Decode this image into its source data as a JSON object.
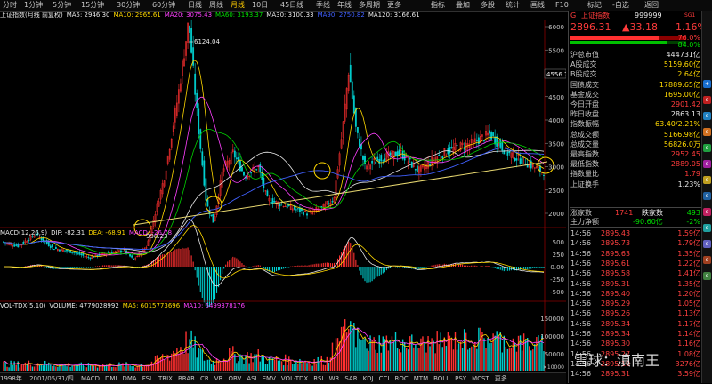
{
  "toolbar": {
    "periods": [
      "分时",
      "1分钟",
      "5分钟",
      "15分钟",
      "30分钟",
      "60分钟",
      "日线",
      "周线",
      "月线",
      "10日",
      "45日线",
      "季线",
      "年线",
      "多周期",
      "更多"
    ],
    "active_period": "月线",
    "right_buttons": [
      "指标",
      "叠加",
      "多股",
      "统计",
      "画线",
      "F10",
      "标记",
      "-自选",
      "返回"
    ]
  },
  "ma_legend": [
    {
      "text": "上证指数(月线 前复权)",
      "color": "#e8e8e8"
    },
    {
      "text": "MA5: 2946.30",
      "color": "#e8e8e8"
    },
    {
      "text": "MA10: 2965.61",
      "color": "#ffd800"
    },
    {
      "text": "MA20: 3075.43",
      "color": "#ff40ff"
    },
    {
      "text": "MA60: 3193.37",
      "color": "#00e000"
    },
    {
      "text": "MA30: 3100.33",
      "color": "#e8e8e8"
    },
    {
      "text": "MA90: 2750.82",
      "color": "#4060ff"
    },
    {
      "text": "MA120: 3166.61",
      "color": "#e8e8e8"
    }
  ],
  "price_axis": [
    "6000",
    "5500",
    "5000",
    "4500",
    "4000",
    "3500",
    "3000",
    "2500",
    "2000"
  ],
  "price_annotations": {
    "high": "6124.04",
    "low": "998.23",
    "right_mark": "4556.7"
  },
  "macd": {
    "legend": [
      {
        "text": "MACD(12,26,9)",
        "color": "#e8e8e8"
      },
      {
        "text": "DIF: -82.31",
        "color": "#e8e8e8"
      },
      {
        "text": "DEA: -68.91",
        "color": "#ffd800"
      },
      {
        "text": "MACD: -26.78",
        "color": "#ff40ff"
      }
    ],
    "axis": [
      "500",
      "250",
      "0.00",
      "-250",
      "-500"
    ]
  },
  "vol": {
    "legend": [
      {
        "text": "VOL-TDX(5,10)",
        "color": "#e8e8e8"
      },
      {
        "text": "VOLUME: 4779028992",
        "color": "#e8e8e8"
      },
      {
        "text": "MA5: 6015773696",
        "color": "#ffd800"
      },
      {
        "text": "MA10: 6499378176",
        "color": "#ff40ff"
      }
    ],
    "axis": [
      "150000",
      "100000",
      "50000"
    ],
    "axis_unit": "×10000"
  },
  "bottom_bar": {
    "start_year": "1998年",
    "date_label": "2001/05/31/四",
    "indicators": [
      "MACD",
      "DMI",
      "DMA",
      "FSL",
      "TRIX",
      "BRAR",
      "CR",
      "VR",
      "OBV",
      "ASI",
      "EMV",
      "VOL-TDX",
      "RSI",
      "WR",
      "SAR",
      "KDJ",
      "CCI",
      "ROC",
      "MTM",
      "BOLL",
      "PSY",
      "MCST",
      "更多"
    ]
  },
  "quote": {
    "index_name": "上证指数",
    "code": "999999",
    "flag": "SG1",
    "price": "2896.31",
    "change": "▲33.18",
    "pct": "1.16%",
    "buy_pct": "76.0%",
    "sell_pct": "84.0%"
  },
  "stats": [
    {
      "k": "沪总市值",
      "v": "444731亿",
      "c": "white"
    },
    {
      "k": "A股成交",
      "v": "5159.60亿",
      "c": "yellow"
    },
    {
      "k": "B股成交",
      "v": "2.64亿",
      "c": "yellow"
    },
    {
      "k": "国债成交",
      "v": "17889.65亿",
      "c": "yellow"
    },
    {
      "k": "基金成交",
      "v": "1695.00亿",
      "c": "yellow"
    },
    {
      "k": "今日开盘",
      "v": "2901.42",
      "c": "red"
    },
    {
      "k": "昨日收盘",
      "v": "2863.13",
      "c": "white"
    },
    {
      "k": "指数振幅",
      "v": "63.40/2.21%",
      "c": "yellow"
    },
    {
      "k": "总成交额",
      "v": "5166.98亿",
      "c": "yellow"
    },
    {
      "k": "总成交量",
      "v": "56826.0万",
      "c": "yellow"
    },
    {
      "k": "最高指数",
      "v": "2952.45",
      "c": "red"
    },
    {
      "k": "最低指数",
      "v": "2889.05",
      "c": "red"
    },
    {
      "k": "指数量比",
      "v": "1.79",
      "c": "red"
    },
    {
      "k": "上证换手",
      "v": "1.23%",
      "c": "white"
    }
  ],
  "breadth": {
    "up_label": "涨家数",
    "up": "1741",
    "down_label": "跌家数",
    "down": "493"
  },
  "netflow": {
    "label": "主力净额",
    "value": "-90.60亿",
    "pct": "-2%"
  },
  "ticks": [
    {
      "t": "14:56",
      "p": "2895.43",
      "q": "1.59亿"
    },
    {
      "t": "14:56",
      "p": "2895.73",
      "q": "1.79亿"
    },
    {
      "t": "14:56",
      "p": "2895.63",
      "q": "1.35亿"
    },
    {
      "t": "14:56",
      "p": "2895.61",
      "q": "1.22亿"
    },
    {
      "t": "14:56",
      "p": "2895.58",
      "q": "1.41亿"
    },
    {
      "t": "14:56",
      "p": "2895.31",
      "q": "1.35亿"
    },
    {
      "t": "14:56",
      "p": "2895.40",
      "q": "1.20亿"
    },
    {
      "t": "14:56",
      "p": "2895.29",
      "q": "1.05亿"
    },
    {
      "t": "14:56",
      "p": "2895.26",
      "q": "1.13亿"
    },
    {
      "t": "14:56",
      "p": "2895.34",
      "q": "1.17亿"
    },
    {
      "t": "14:56",
      "p": "2895.34",
      "q": "1.14亿"
    },
    {
      "t": "14:56",
      "p": "2895.30",
      "q": "1.16亿"
    },
    {
      "t": "14:56",
      "p": "2895.27",
      "q": "1.08亿"
    },
    {
      "t": "14:56",
      "p": "2895.10",
      "q": "3276亿"
    },
    {
      "t": "14:56",
      "p": "2895.31",
      "q": "3.59亿"
    }
  ],
  "side_icons": [
    "+",
    "o",
    "o",
    "o",
    "o",
    "o",
    "o",
    "o",
    "o",
    "o",
    "o",
    "o",
    "o"
  ],
  "watermark": "雪球：滇南王"
}
